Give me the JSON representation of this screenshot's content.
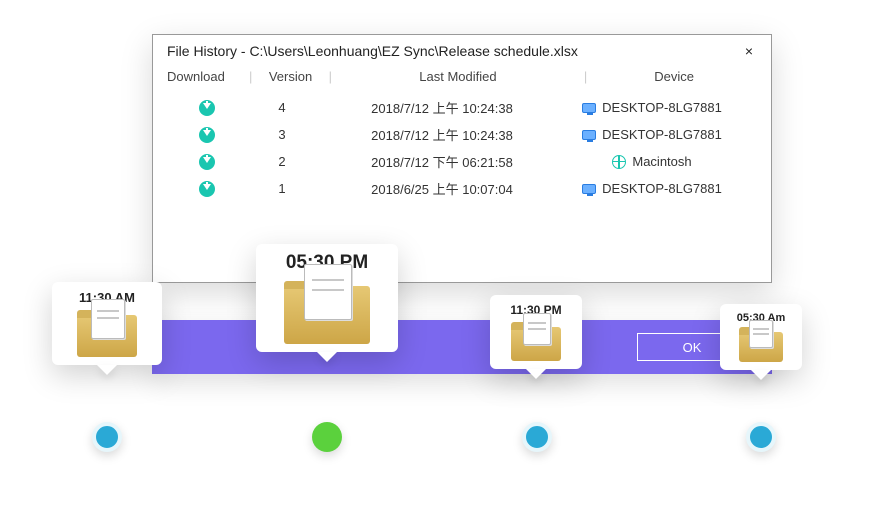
{
  "dialog": {
    "title": "File History - C:\\Users\\Leonhuang\\EZ Sync\\Release schedule.xlsx",
    "columns": {
      "download": "Download",
      "version": "Version",
      "modified": "Last Modified",
      "device": "Device"
    },
    "rows": [
      {
        "version": "4",
        "modified": "2018/7/12 上午 10:24:38",
        "device": "DESKTOP-8LG7881",
        "device_type": "desktop"
      },
      {
        "version": "3",
        "modified": "2018/7/12 上午 10:24:38",
        "device": "DESKTOP-8LG7881",
        "device_type": "desktop"
      },
      {
        "version": "2",
        "modified": "2018/7/12 下午 06:21:58",
        "device": "Macintosh",
        "device_type": "web"
      },
      {
        "version": "1",
        "modified": "2018/6/25 上午 10:07:04",
        "device": "DESKTOP-8LG7881",
        "device_type": "desktop"
      }
    ],
    "ok_label": "OK"
  },
  "timeline": {
    "snapshots": [
      {
        "time": "11:30 AM"
      },
      {
        "time": "05:30 PM"
      },
      {
        "time": "11:30 PM"
      },
      {
        "time": "05:30 Am"
      }
    ]
  }
}
